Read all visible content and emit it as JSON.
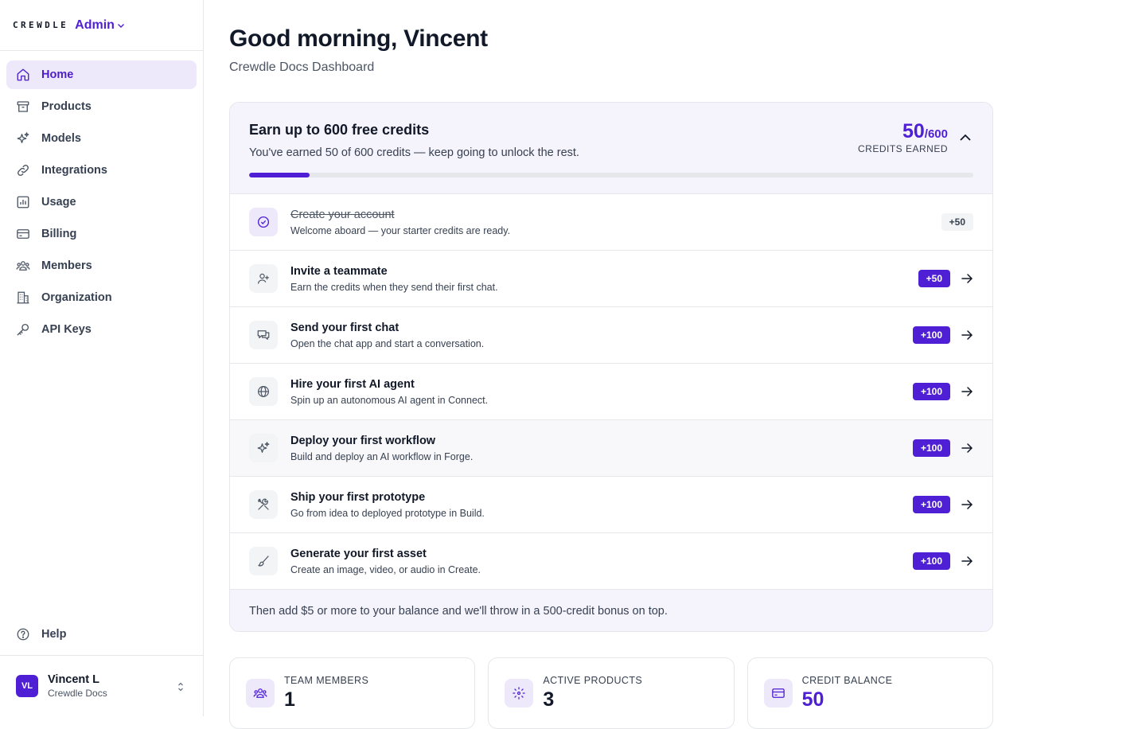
{
  "brand": {
    "logo_text": "CREWDLE",
    "admin_label": "Admin"
  },
  "sidebar": {
    "items": [
      {
        "label": "Home",
        "icon": "home-icon",
        "active": true
      },
      {
        "label": "Products",
        "icon": "archive-icon"
      },
      {
        "label": "Models",
        "icon": "sparkles-icon"
      },
      {
        "label": "Integrations",
        "icon": "link-icon"
      },
      {
        "label": "Usage",
        "icon": "bar-chart-icon"
      },
      {
        "label": "Billing",
        "icon": "credit-card-icon"
      },
      {
        "label": "Members",
        "icon": "users-icon"
      },
      {
        "label": "Organization",
        "icon": "building-icon"
      },
      {
        "label": "API Keys",
        "icon": "key-icon"
      }
    ],
    "help_label": "Help",
    "user": {
      "initials": "VL",
      "name": "Vincent L",
      "org": "Crewdle Docs"
    }
  },
  "header": {
    "greeting": "Good morning, Vincent",
    "subtitle": "Crewdle Docs Dashboard"
  },
  "credits": {
    "title": "Earn up to 600 free credits",
    "description": "You've earned 50 of 600 credits — keep going to unlock the rest.",
    "earned": "50",
    "max": "/600",
    "earned_label": "CREDITS EARNED",
    "progress_fraction": 0.0833,
    "accent_color": "#4f1fd6",
    "tasks": [
      {
        "title": "Create your account",
        "desc": "Welcome aboard — your starter credits are ready.",
        "reward": "+50",
        "completed": true,
        "icon": "check-circle-icon"
      },
      {
        "title": "Invite a teammate",
        "desc": "Earn the credits when they send their first chat.",
        "reward": "+50",
        "icon": "user-plus-icon"
      },
      {
        "title": "Send your first chat",
        "desc": "Open the chat app and start a conversation.",
        "reward": "+100",
        "icon": "chat-icon"
      },
      {
        "title": "Hire your first AI agent",
        "desc": "Spin up an autonomous AI agent in Connect.",
        "reward": "+100",
        "icon": "globe-icon"
      },
      {
        "title": "Deploy your first workflow",
        "desc": "Build and deploy an AI workflow in Forge.",
        "reward": "+100",
        "icon": "sparkles-icon"
      },
      {
        "title": "Ship your first prototype",
        "desc": "Go from idea to deployed prototype in Build.",
        "reward": "+100",
        "icon": "tools-icon"
      },
      {
        "title": "Generate your first asset",
        "desc": "Create an image, video, or audio in Create.",
        "reward": "+100",
        "icon": "brush-icon"
      }
    ],
    "bonus_text": "Then add $5 or more to your balance and we'll throw in a 500-credit bonus on top."
  },
  "stats": [
    {
      "label": "TEAM MEMBERS",
      "value": "1",
      "icon": "users-icon"
    },
    {
      "label": "ACTIVE PRODUCTS",
      "value": "3",
      "icon": "dashed-box-icon"
    },
    {
      "label": "CREDIT BALANCE",
      "value": "50",
      "icon": "credit-card-icon",
      "accent": true
    }
  ]
}
